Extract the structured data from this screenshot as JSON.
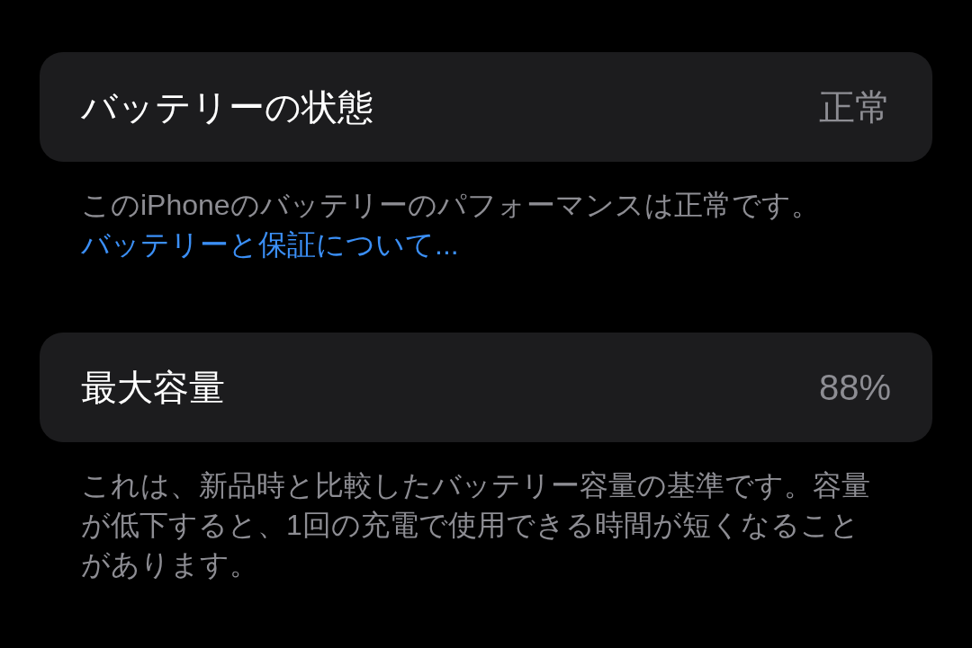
{
  "sections": [
    {
      "title": "バッテリーの状態",
      "value": "正常",
      "footer": "このiPhoneのバッテリーのパフォーマンスは正常です。",
      "link": "バッテリーと保証について..."
    },
    {
      "title": "最大容量",
      "value": "88%",
      "footer": "これは、新品時と比較したバッテリー容量の基準です。容量が低下すると、1回の充電で使用できる時間が短くなることがあります。"
    }
  ]
}
